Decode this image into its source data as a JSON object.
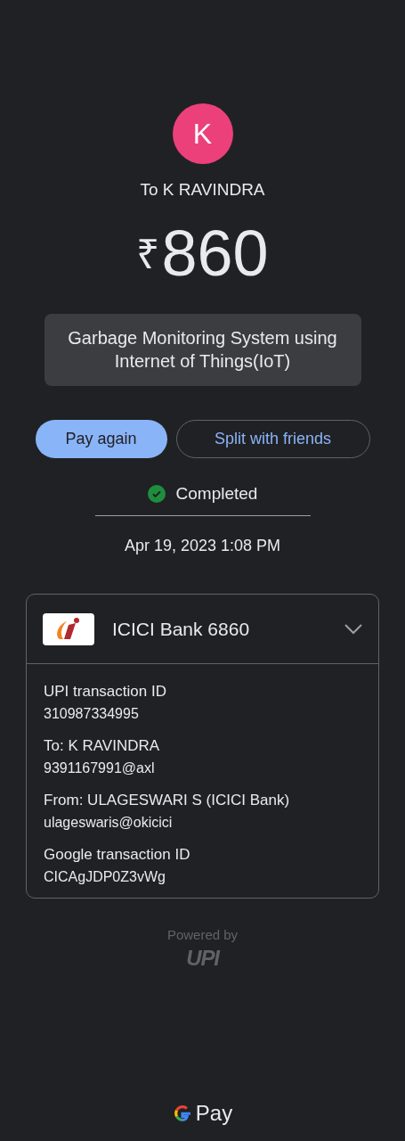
{
  "payee": {
    "initial": "K",
    "color": "#ec407a",
    "label": "To K RAVINDRA"
  },
  "amount": {
    "currency": "₹",
    "value": "860"
  },
  "note": "Garbage Monitoring System using Internet of Things(IoT)",
  "buttons": [
    {
      "label": "Pay again",
      "kind": "filled"
    },
    {
      "label": "Split with friends",
      "kind": "outlined"
    }
  ],
  "status": {
    "label": "Completed",
    "kind": "success"
  },
  "datetime": "Apr 19, 2023 1:08 PM",
  "account": {
    "label": "ICICI Bank 6860",
    "expanded": true,
    "details": [
      {
        "label": "UPI transaction ID",
        "value": "310987334995"
      },
      {
        "label": "To: K RAVINDRA",
        "value": "9391167991@axl"
      },
      {
        "label": "From: ULAGESWARI S (ICICI Bank)",
        "value": "ulageswaris@okicici"
      },
      {
        "label": "Google transaction ID",
        "value": "CICAgJDP0Z3vWg"
      }
    ]
  },
  "powered_by": {
    "label": "Powered by",
    "logo": "UPI"
  },
  "footer": {
    "brand": "Pay"
  }
}
